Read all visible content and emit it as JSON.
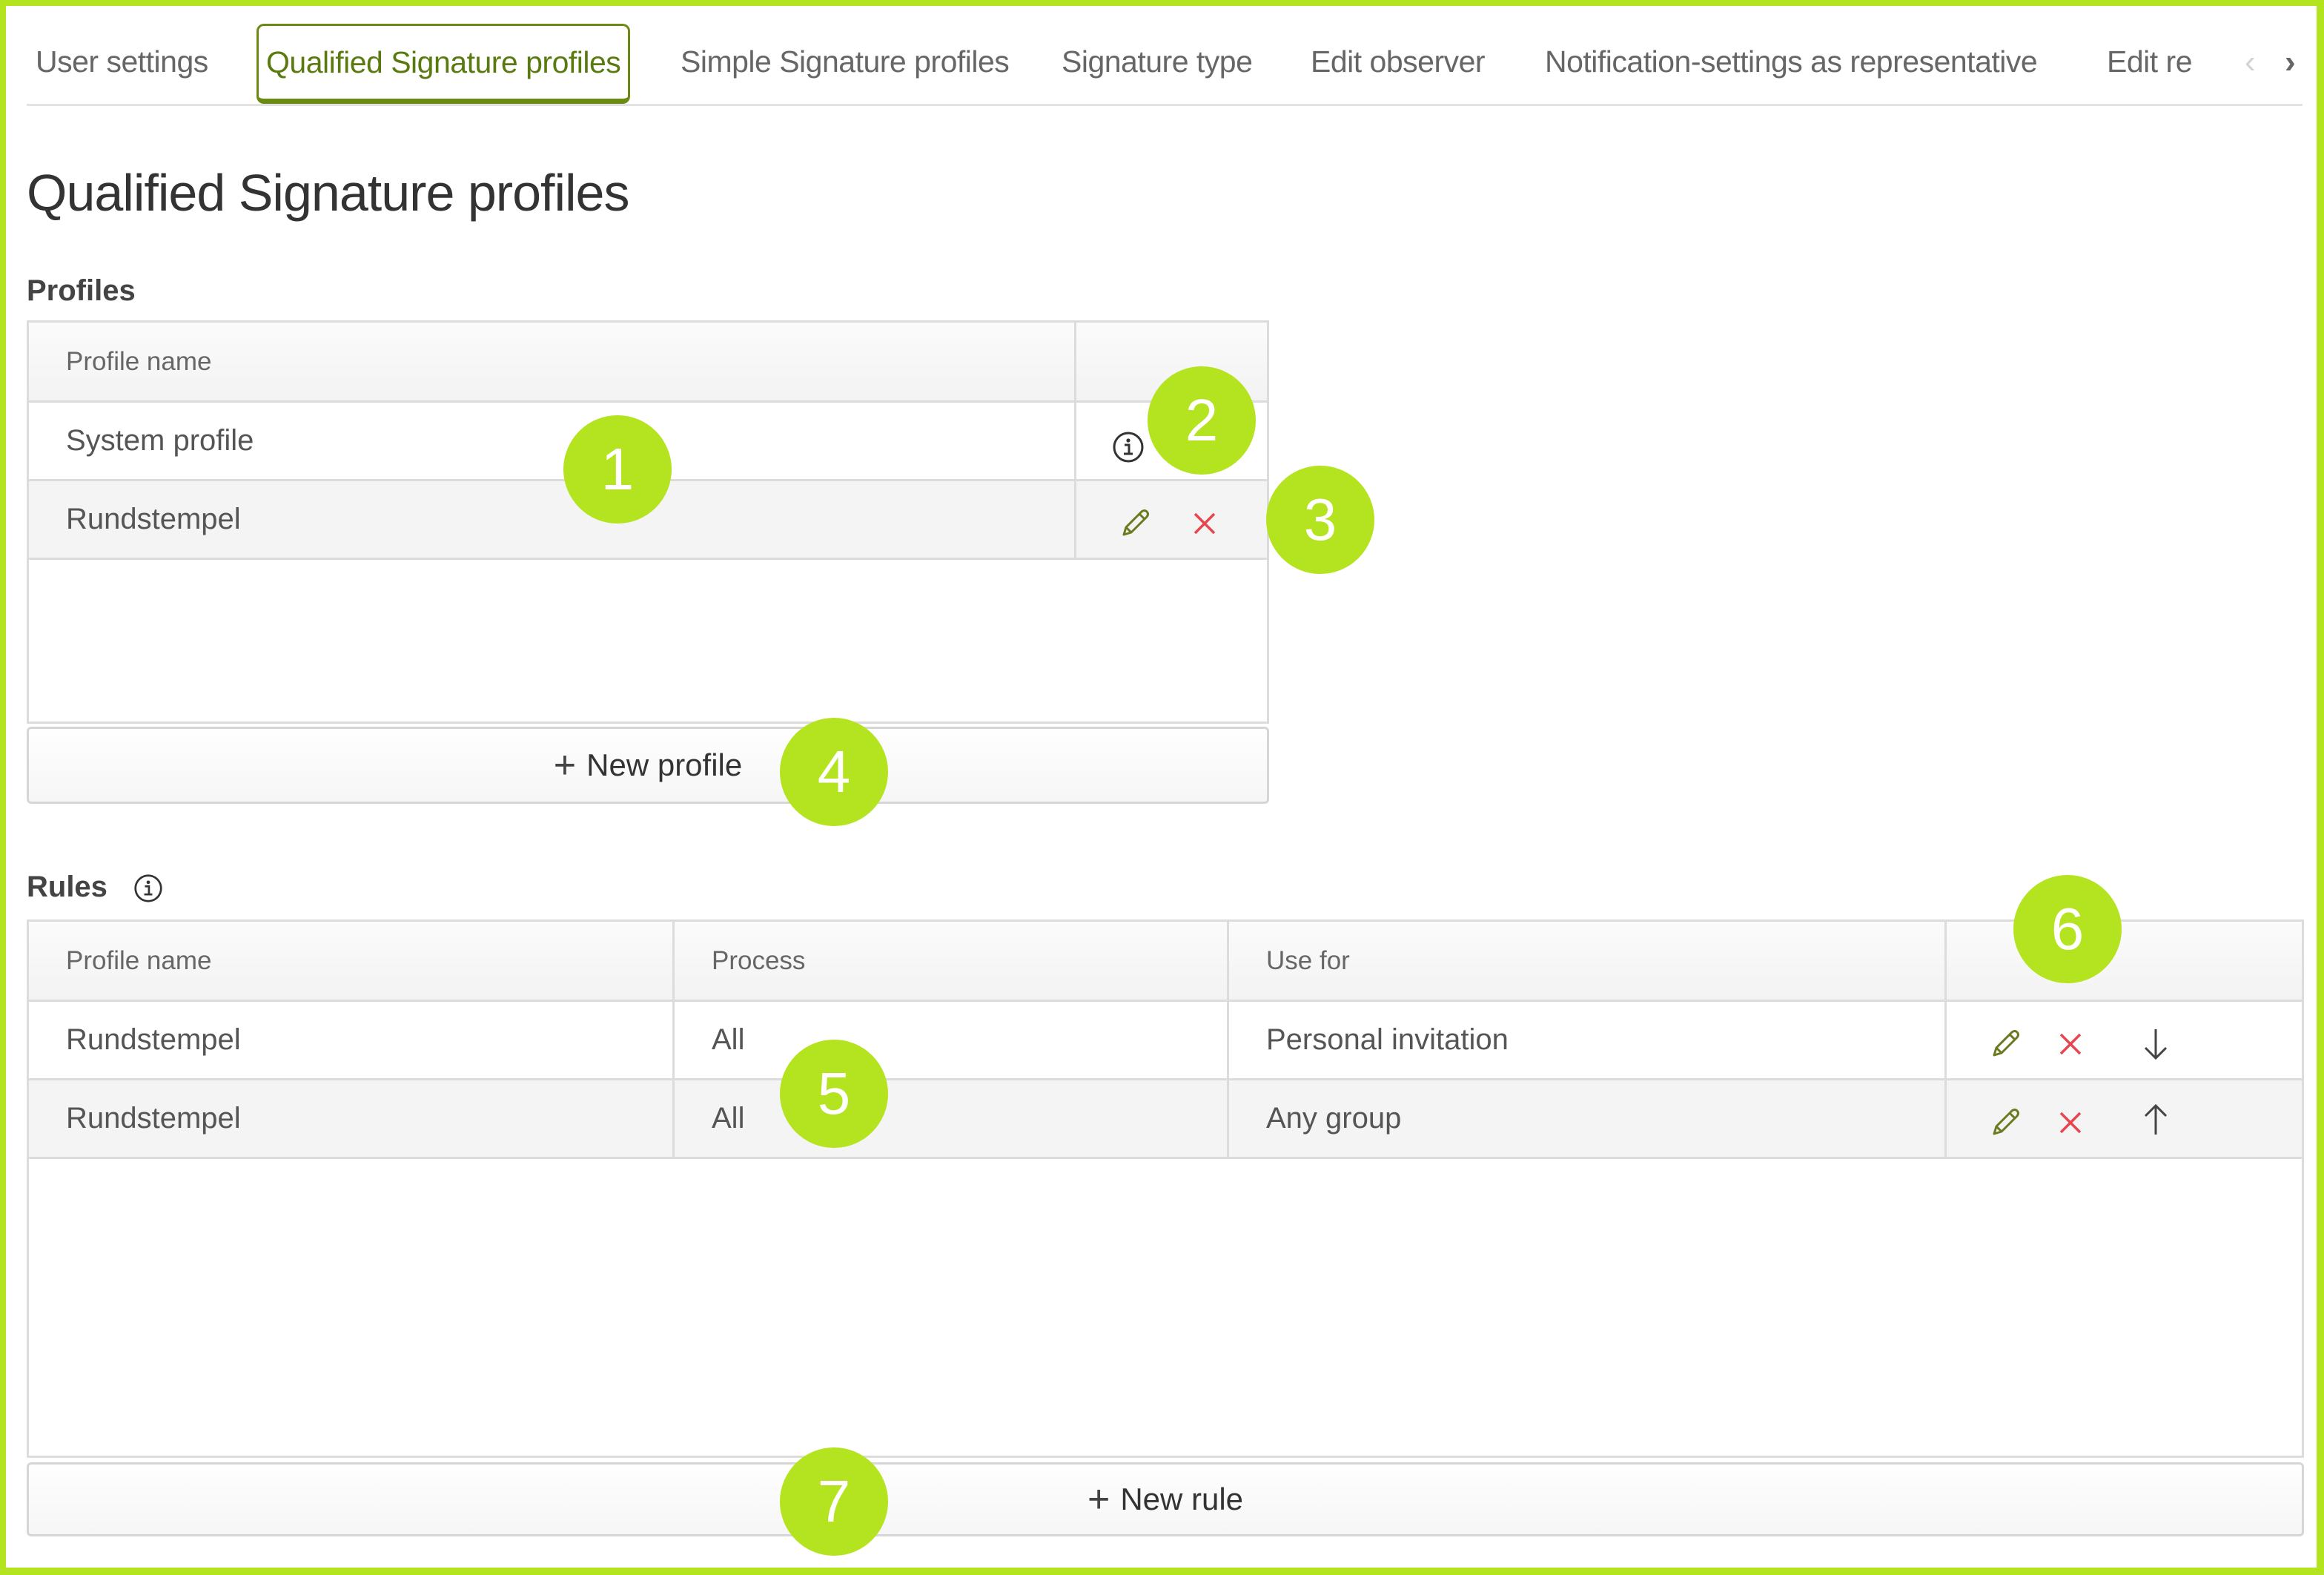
{
  "tabs": [
    {
      "label": "User settings",
      "active": false
    },
    {
      "label": "Qualified Signature profiles",
      "active": true
    },
    {
      "label": "Simple Signature profiles",
      "active": false
    },
    {
      "label": "Signature type",
      "active": false
    },
    {
      "label": "Edit observer",
      "active": false
    },
    {
      "label": "Notification-settings as representative",
      "active": false
    },
    {
      "label": "Edit re",
      "active": false
    }
  ],
  "tab_scroll": {
    "prev_icon": "chevron-left-icon",
    "next_icon": "chevron-right-icon",
    "prev_glyph": "‹",
    "next_glyph": "›"
  },
  "page_title": "Qualified Signature profiles",
  "profiles": {
    "title": "Profiles",
    "columns": [
      "Profile name",
      ""
    ],
    "rows": [
      {
        "name": "System profile",
        "actions": [
          "info"
        ]
      },
      {
        "name": "Rundstempel",
        "actions": [
          "edit",
          "delete"
        ]
      }
    ],
    "new_button": "New profile"
  },
  "rules": {
    "title": "Rules",
    "columns": [
      "Profile name",
      "Process",
      "Use for",
      ""
    ],
    "rows": [
      {
        "profile": "Rundstempel",
        "process": "All",
        "use_for": "Personal invitation",
        "actions": [
          "edit",
          "delete",
          "move-down"
        ]
      },
      {
        "profile": "Rundstempel",
        "process": "All",
        "use_for": "Any group",
        "actions": [
          "edit",
          "delete",
          "move-up"
        ]
      }
    ],
    "new_button": "New rule"
  },
  "markers": [
    "1",
    "2",
    "3",
    "4",
    "5",
    "6",
    "7"
  ],
  "colors": {
    "accent": "#b4e31f",
    "active_tab": "#6a8a14",
    "delete": "#e8454f",
    "edit": "#6b7a1e"
  }
}
